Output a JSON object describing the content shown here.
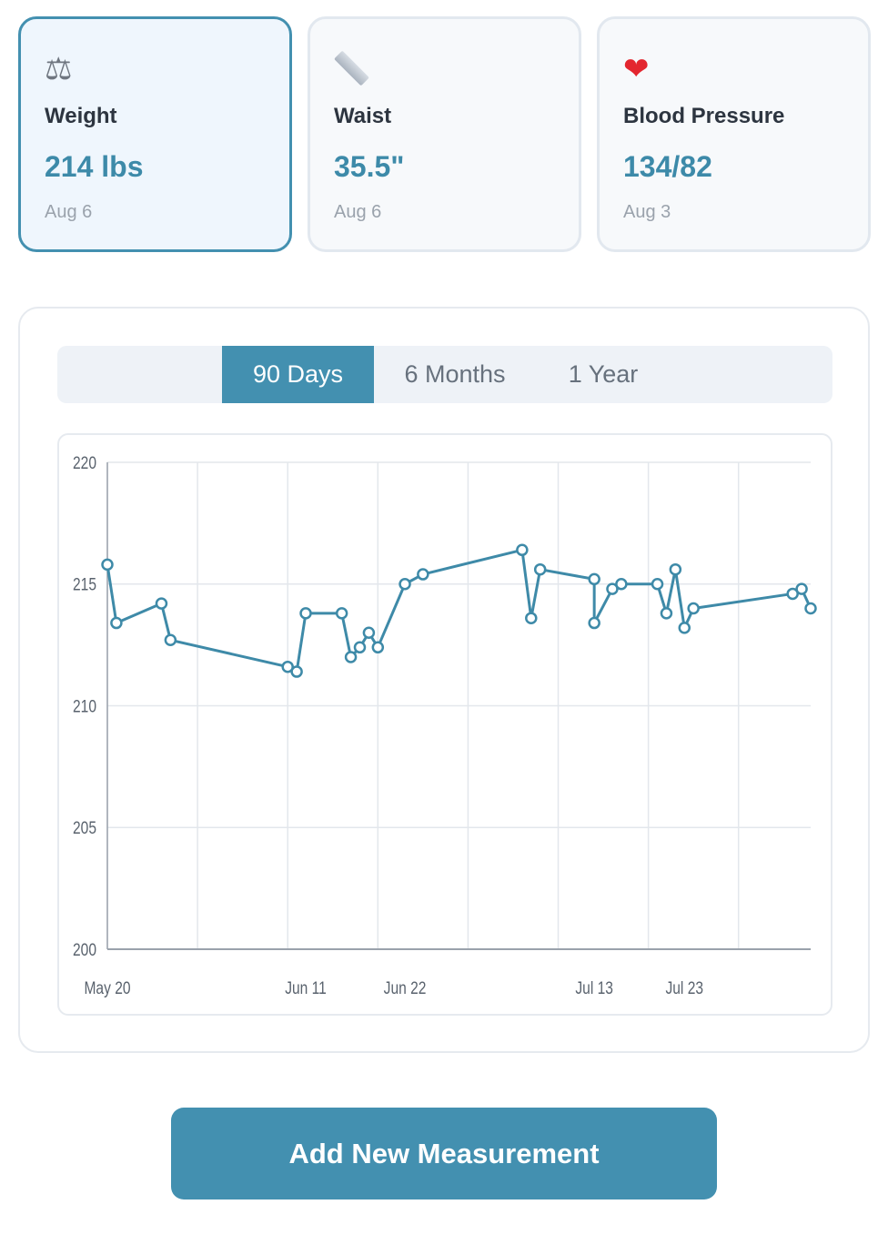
{
  "cards": [
    {
      "name": "Weight",
      "value": "214 lbs",
      "date": "Aug 6",
      "icon": "scale-icon",
      "active": true
    },
    {
      "name": "Waist",
      "value": "35.5\"",
      "date": "Aug 6",
      "icon": "ruler-icon",
      "active": false
    },
    {
      "name": "Blood Pressure",
      "value": "134/82",
      "date": "Aug 3",
      "icon": "heart-icon",
      "active": false
    }
  ],
  "range_tabs": [
    {
      "label": "90 Days",
      "active": true
    },
    {
      "label": "6 Months",
      "active": false
    },
    {
      "label": "1 Year",
      "active": false
    }
  ],
  "chart_data": {
    "type": "line",
    "title": "",
    "xlabel": "",
    "ylabel": "",
    "ylim": [
      200,
      220
    ],
    "yticks": [
      200,
      205,
      210,
      215,
      220
    ],
    "xlim": [
      "2024-05-20",
      "2024-08-06"
    ],
    "xticks": [
      {
        "label": "May 20",
        "date": "2024-05-20"
      },
      {
        "label": "Jun 11",
        "date": "2024-06-11"
      },
      {
        "label": "Jun 22",
        "date": "2024-06-22"
      },
      {
        "label": "Jul 13",
        "date": "2024-07-13"
      },
      {
        "label": "Jul 23",
        "date": "2024-07-23"
      }
    ],
    "grid": true,
    "line_color": "#3e8aa8",
    "series": [
      {
        "points": [
          {
            "x": "2024-05-20",
            "y": 215.8
          },
          {
            "x": "2024-05-21",
            "y": 213.4
          },
          {
            "x": "2024-05-26",
            "y": 214.2
          },
          {
            "x": "2024-05-27",
            "y": 212.7
          },
          {
            "x": "2024-06-09",
            "y": 211.6
          },
          {
            "x": "2024-06-10",
            "y": 211.4
          },
          {
            "x": "2024-06-11",
            "y": 213.8
          },
          {
            "x": "2024-06-15",
            "y": 213.8
          },
          {
            "x": "2024-06-16",
            "y": 212.0
          },
          {
            "x": "2024-06-17",
            "y": 212.4
          },
          {
            "x": "2024-06-18",
            "y": 213.0
          },
          {
            "x": "2024-06-19",
            "y": 212.4
          },
          {
            "x": "2024-06-22",
            "y": 215.0
          },
          {
            "x": "2024-06-24",
            "y": 215.4
          },
          {
            "x": "2024-07-05",
            "y": 216.4
          },
          {
            "x": "2024-07-06",
            "y": 213.6
          },
          {
            "x": "2024-07-07",
            "y": 215.6
          },
          {
            "x": "2024-07-13",
            "y": 215.2
          },
          {
            "x": "2024-07-13",
            "y": 213.4
          },
          {
            "x": "2024-07-15",
            "y": 214.8
          },
          {
            "x": "2024-07-16",
            "y": 215.0
          },
          {
            "x": "2024-07-20",
            "y": 215.0
          },
          {
            "x": "2024-07-21",
            "y": 213.8
          },
          {
            "x": "2024-07-22",
            "y": 215.6
          },
          {
            "x": "2024-07-23",
            "y": 213.2
          },
          {
            "x": "2024-07-24",
            "y": 214.0
          },
          {
            "x": "2024-08-04",
            "y": 214.6
          },
          {
            "x": "2024-08-05",
            "y": 214.8
          },
          {
            "x": "2024-08-06",
            "y": 214.0
          }
        ]
      }
    ]
  },
  "add_button": {
    "label": "Add New Measurement"
  }
}
